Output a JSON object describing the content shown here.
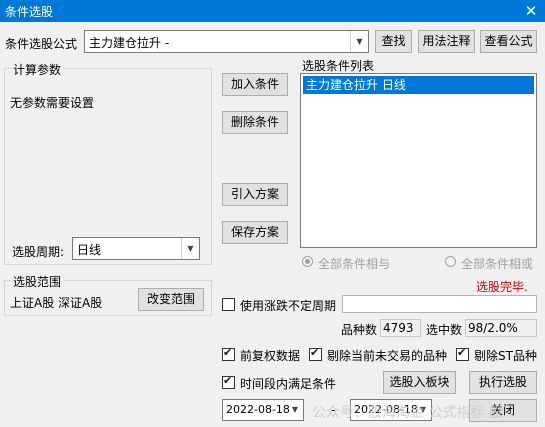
{
  "window": {
    "title": "条件选股",
    "close": "✕"
  },
  "formula": {
    "label": "条件选股公式",
    "value": "主力建仓拉升 -",
    "find_button": "查找",
    "usage_button": "用法注释",
    "view_button": "查看公式"
  },
  "params": {
    "legend": "计算参数",
    "message": "无参数需要设置",
    "period_label": "选股周期:",
    "period_value": "日线"
  },
  "actions": {
    "add": "加入条件",
    "delete": "删除条件",
    "import": "引入方案",
    "save": "保存方案"
  },
  "condition_list": {
    "label": "选股条件列表",
    "items": [
      "主力建仓拉升  日线"
    ]
  },
  "logic": {
    "all_and": "全部条件相与",
    "all_or": "全部条件相或"
  },
  "status": {
    "text": "选股完毕.",
    "color": "#e00000"
  },
  "scope": {
    "legend": "选股范围",
    "markets": "上证A股 深证A股",
    "change_button": "改变范围"
  },
  "options": {
    "use_limit_period": "使用涨跌不定周期",
    "count_label": "品种数",
    "count_value": "4793",
    "selected_label": "选中数",
    "selected_value": "98/2.0%",
    "forward_adjust": "前复权数据",
    "exclude_untraded": "剔除当前未交易的品种",
    "exclude_st": "剔除ST品种",
    "period_satisfy": "时间段内满足条件"
  },
  "bottom": {
    "to_block_button": "选股入板块",
    "run_button": "执行选股",
    "close_button": "关闭",
    "start_date": "2022-08-18",
    "end_date": "2022-08-18",
    "dash": "-"
  },
  "watermark": "公众号：股海淘金  公式指标 股"
}
